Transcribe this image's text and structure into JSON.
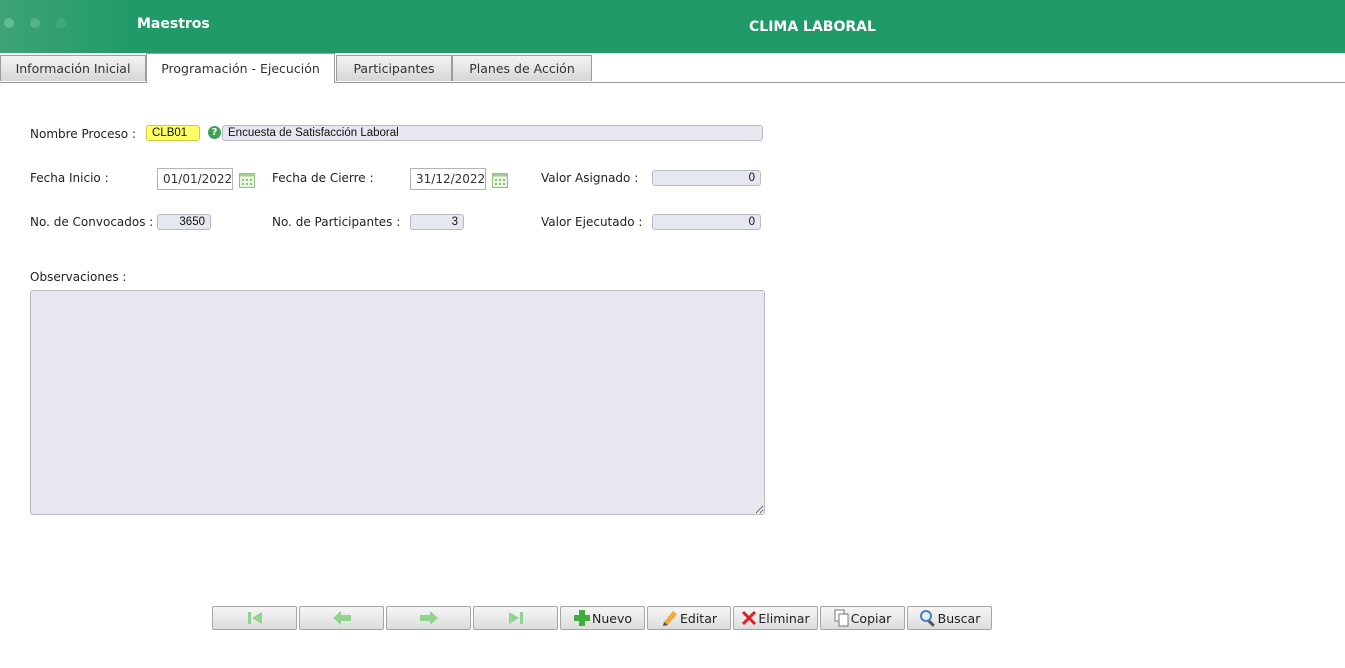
{
  "header": {
    "left_title": "Maestros",
    "title": "CLIMA LABORAL"
  },
  "tabs": [
    {
      "label": "Información Inicial"
    },
    {
      "label": "Programación - Ejecución"
    },
    {
      "label": "Participantes"
    },
    {
      "label": "Planes de Acción"
    }
  ],
  "form": {
    "nombre_proceso": {
      "label": "Nombre Proceso :",
      "code": "CLB01",
      "description": "Encuesta de Satisfacción Laboral"
    },
    "fecha_inicio": {
      "label": "Fecha Inicio :",
      "value": "01/01/2022"
    },
    "fecha_cierre": {
      "label": "Fecha de Cierre :",
      "value": "31/12/2022"
    },
    "valor_asignado": {
      "label": "Valor Asignado :",
      "value": "0"
    },
    "convocados": {
      "label": "No. de Convocados :",
      "value": "3650"
    },
    "participantes": {
      "label": "No. de Participantes :",
      "value": "3"
    },
    "valor_ejecutado": {
      "label": "Valor Ejecutado :",
      "value": "0"
    },
    "observaciones": {
      "label": "Observaciones :",
      "value": ""
    }
  },
  "toolbar": {
    "nuevo": "Nuevo",
    "editar": "Editar",
    "eliminar": "Eliminar",
    "copiar": "Copiar",
    "buscar": "Buscar"
  },
  "colors": {
    "header": "#1f9a68",
    "field_bg": "#e6e7ef",
    "code_bg": "#ffff66"
  }
}
